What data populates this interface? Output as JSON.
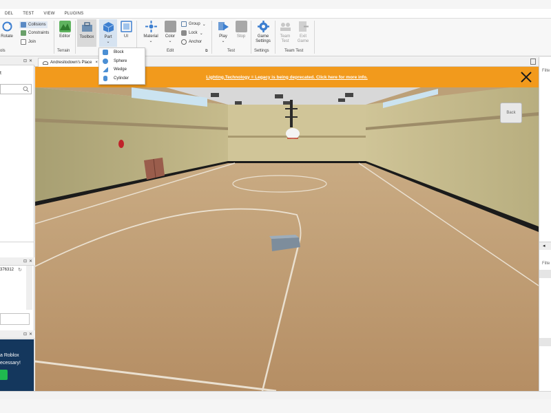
{
  "menubar": {
    "items": [
      "DEL",
      "TEST",
      "VIEW",
      "PLUGINS"
    ]
  },
  "ribbon": {
    "tools": {
      "rotate_label": "Rotate",
      "group_label": "ols"
    },
    "collisions_label": "Collisions",
    "constraints_label": "Constraints",
    "join_label": "Join",
    "editor_label": "Editor",
    "toolbox_label": "Toolbox",
    "terrain_group_label": "Terrain",
    "part_label": "Part",
    "ui_label": "UI",
    "material_label": "Material",
    "color_label": "Color",
    "group_label": "Group",
    "lock_label": "Lock",
    "anchor_label": "Anchor",
    "edit_group_label": "Edit",
    "play_label": "Play",
    "stop_label": "Stop",
    "test_group_label": "Test",
    "game_settings_label": "Game Settings",
    "settings_group_label": "Settings",
    "team_test_label": "Team Test",
    "exit_game_label": "Exit Game",
    "team_test_group_label": "Team Test"
  },
  "part_dropdown": {
    "items": [
      "Block",
      "Sphere",
      "Wedge",
      "Cylinder"
    ]
  },
  "document_tab": {
    "title": "Andresitodown's Place",
    "close": "×"
  },
  "banner": {
    "text": "Lighting.Technology = Legacy is being deprecated. Click here for more info."
  },
  "left_panel": {
    "explorer_fragment": "t",
    "id_fragment": "376312",
    "promo_line1": "a Roblox",
    "promo_line2": "ecessary!"
  },
  "right_panel": {
    "filter1": "Filte",
    "filter2": "Filte"
  },
  "viewport": {
    "cube_label": "Back"
  },
  "colors": {
    "banner": "#f29a1c",
    "accent": "#4b8fd4",
    "promo_bg": "#14375d",
    "promo_button": "#1fb84f"
  }
}
